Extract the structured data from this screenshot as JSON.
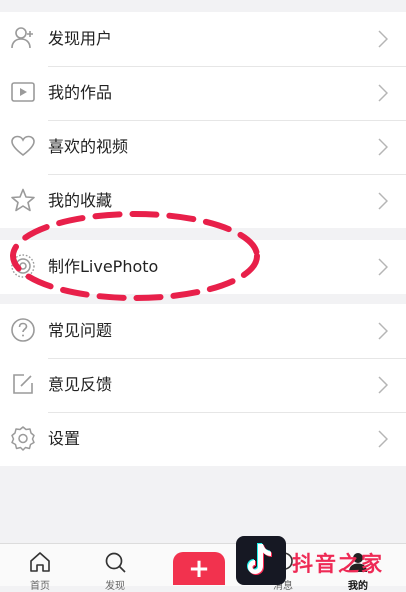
{
  "menu": {
    "group1": [
      {
        "label": "发现用户",
        "icon": "add-user-icon"
      },
      {
        "label": "我的作品",
        "icon": "play-box-icon"
      },
      {
        "label": "喜欢的视频",
        "icon": "heart-icon"
      },
      {
        "label": "我的收藏",
        "icon": "star-icon"
      }
    ],
    "group2": [
      {
        "label": "制作LivePhoto",
        "icon": "livephoto-icon"
      }
    ],
    "group3": [
      {
        "label": "常见问题",
        "icon": "help-icon"
      },
      {
        "label": "意见反馈",
        "icon": "feedback-icon"
      },
      {
        "label": "设置",
        "icon": "settings-icon"
      }
    ]
  },
  "tabbar": {
    "tabs": [
      {
        "label": "首页",
        "icon": "home-icon"
      },
      {
        "label": "发现",
        "icon": "search-icon"
      },
      {
        "label": "消息",
        "icon": "message-icon"
      },
      {
        "label": "我的",
        "icon": "profile-icon"
      }
    ],
    "create_label": "+"
  },
  "watermark": {
    "text": "抖音之家"
  },
  "colors": {
    "accent": "#f2324e",
    "annotation": "#e8204a",
    "icon": "#9a9a9a"
  }
}
